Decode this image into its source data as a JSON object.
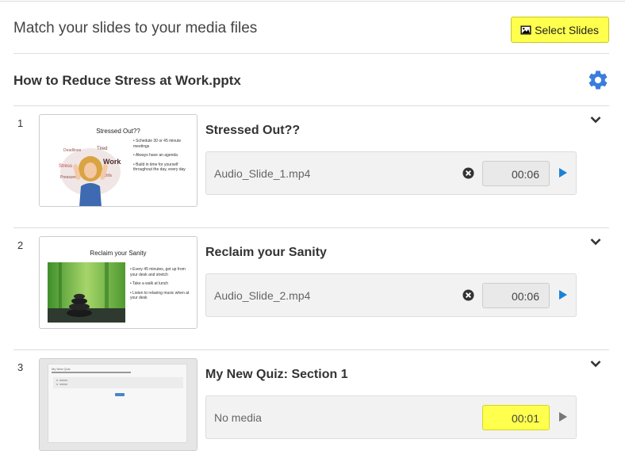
{
  "header": {
    "title": "Match your slides to your media files",
    "select_slides_label": "Select Slides"
  },
  "presentation": {
    "file_name": "How to Reduce Stress at Work.pptx"
  },
  "slides": [
    {
      "number": "1",
      "title": "Stressed Out??",
      "thumb": {
        "title": "Stressed Out??",
        "bullets": [
          "Schedule 30 or 45 minute meetings",
          "Always have an agenda",
          "Build in time for yourself throughout the day, every day"
        ]
      },
      "media": "Audio_Slide_1.mp4",
      "time": "00:06",
      "has_media": true
    },
    {
      "number": "2",
      "title": "Reclaim your Sanity",
      "thumb": {
        "title": "Reclaim your Sanity",
        "bullets": [
          "Every 45 minutes, get up from your desk and stretch",
          "Take a walk at lunch",
          "Listen to relaxing music when at your desk"
        ]
      },
      "media": "Audio_Slide_2.mp4",
      "time": "00:06",
      "has_media": true
    },
    {
      "number": "3",
      "title": "My New Quiz: Section 1",
      "thumb": {
        "title": "My New Quiz",
        "bullets": []
      },
      "media": "No media",
      "time": "00:01",
      "has_media": false
    }
  ],
  "colors": {
    "accent_yellow": "#ffff4d",
    "gear_blue": "#3b7ddd",
    "play_blue": "#1a82d6",
    "play_gray": "#777777"
  },
  "icons": {
    "select": "image-icon",
    "settings": "gear-icon",
    "expand": "chevron-down-icon",
    "remove": "remove-circle-icon",
    "play": "play-icon"
  }
}
